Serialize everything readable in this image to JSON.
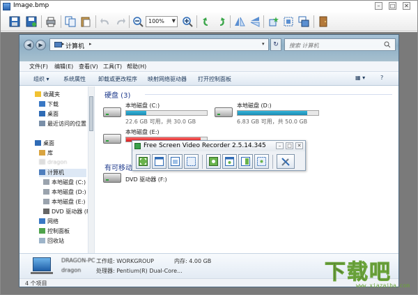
{
  "viewer": {
    "title": "Image.bmp",
    "zoom": "100%",
    "window_buttons": {
      "minimize": "–",
      "maximize": "□",
      "close": "✕"
    }
  },
  "explorer": {
    "address": {
      "crumb": "计算机",
      "root_arrow": "▸",
      "crumb_arrow": "▸",
      "dropdown": "▾"
    },
    "search_placeholder": "搜索 计算机",
    "refresh_symbol": "↻",
    "menus": [
      "文件(F)",
      "编辑(E)",
      "查看(V)",
      "工具(T)",
      "帮助(H)"
    ],
    "commands": [
      "组织 ▾",
      "系统属性",
      "卸载或更改程序",
      "映射网络驱动器",
      "打开控制面板"
    ],
    "view_symbol": "▦ ▾",
    "help_symbol": "?",
    "nav": {
      "favorites": "收藏夹",
      "downloads": "下载",
      "desktop_fav": "桌面",
      "recent": "最近访问的位置",
      "desktop": "桌面",
      "library": "库",
      "user": "dragon",
      "computer": "计算机",
      "drive_c": "本地磁盘 (C:)",
      "drive_d": "本地磁盘 (D:)",
      "drive_e": "本地磁盘 (E:)",
      "dvd": "DVD 驱动器 (F",
      "network": "网络",
      "control_panel": "控制面板",
      "recycle": "回收站"
    },
    "groups": {
      "hard_disks": "硬盘 (3)",
      "removable": "有可移动"
    },
    "drives": [
      {
        "name": "本地磁盘 (C:)",
        "free": "22.6 GB 可用，共 30.0 GB",
        "used_fraction": 0.25,
        "color": "#1b8bb4"
      },
      {
        "name": "本地磁盘 (D:)",
        "free": "6.83 GB 可用，共 50.0 GB",
        "used_fraction": 0.86,
        "color": "#1b8bb4"
      },
      {
        "name": "本地磁盘 (E:)",
        "free": "",
        "used_fraction": 0.92,
        "color": "#d81818"
      }
    ],
    "dvd_drive": "DVD 驱动器 (F:)",
    "details": {
      "computer_name": "DRAGON-PC",
      "user_blur": "dragon",
      "workgroup": "工作组: WORKGROUP",
      "memory": "内存: 4.00 GB",
      "processor": "处理器: Pentium(R) Dual-Core..."
    },
    "status": "4 个项目"
  },
  "recorder": {
    "title": "Free Screen Video Recorder 2.5.14.345",
    "buttons": [
      "capture-fullscreen",
      "capture-window",
      "capture-object",
      "capture-region",
      "record-fullscreen",
      "record-window",
      "record-object",
      "record-region",
      "settings"
    ]
  },
  "watermark": {
    "logo": "下载吧",
    "url": "www.xiazaiba.com"
  }
}
